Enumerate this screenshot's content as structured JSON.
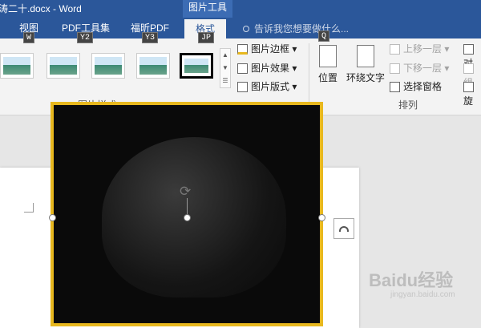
{
  "title_bar": {
    "title": "涛二十.docx - Word",
    "context_tools_label": "图片工具"
  },
  "tabs": [
    {
      "label": "视图",
      "keytip": "W"
    },
    {
      "label": "PDF工具集",
      "keytip": "Y2"
    },
    {
      "label": "福昕PDF",
      "keytip": "Y3"
    },
    {
      "label": "格式",
      "keytip": "JP"
    }
  ],
  "tell_me": {
    "placeholder": "告诉我您想要做什么...",
    "keytip": "Q"
  },
  "picture_styles": {
    "group_label": "图片样式",
    "selected_index": 4
  },
  "picture_commands": {
    "border": "图片边框",
    "effects": "图片效果",
    "layout": "图片版式"
  },
  "arrange": {
    "group_label": "排列",
    "position": "位置",
    "wrap_text": "环绕文字",
    "bring_forward": "上移一层",
    "send_backward": "下移一层",
    "selection_pane": "选择窗格",
    "align_partial": "对",
    "group_partial": "组",
    "rotate_partial": "旋"
  },
  "watermark": {
    "text": "Baidu经验",
    "sub": "jingyan.baidu.com"
  },
  "colors": {
    "ribbon_blue": "#2b579a",
    "picture_border": "#e8b81e"
  },
  "icons": [
    "rotate-handle-icon",
    "layout-options-icon",
    "tell-me-bulb-icon"
  ]
}
